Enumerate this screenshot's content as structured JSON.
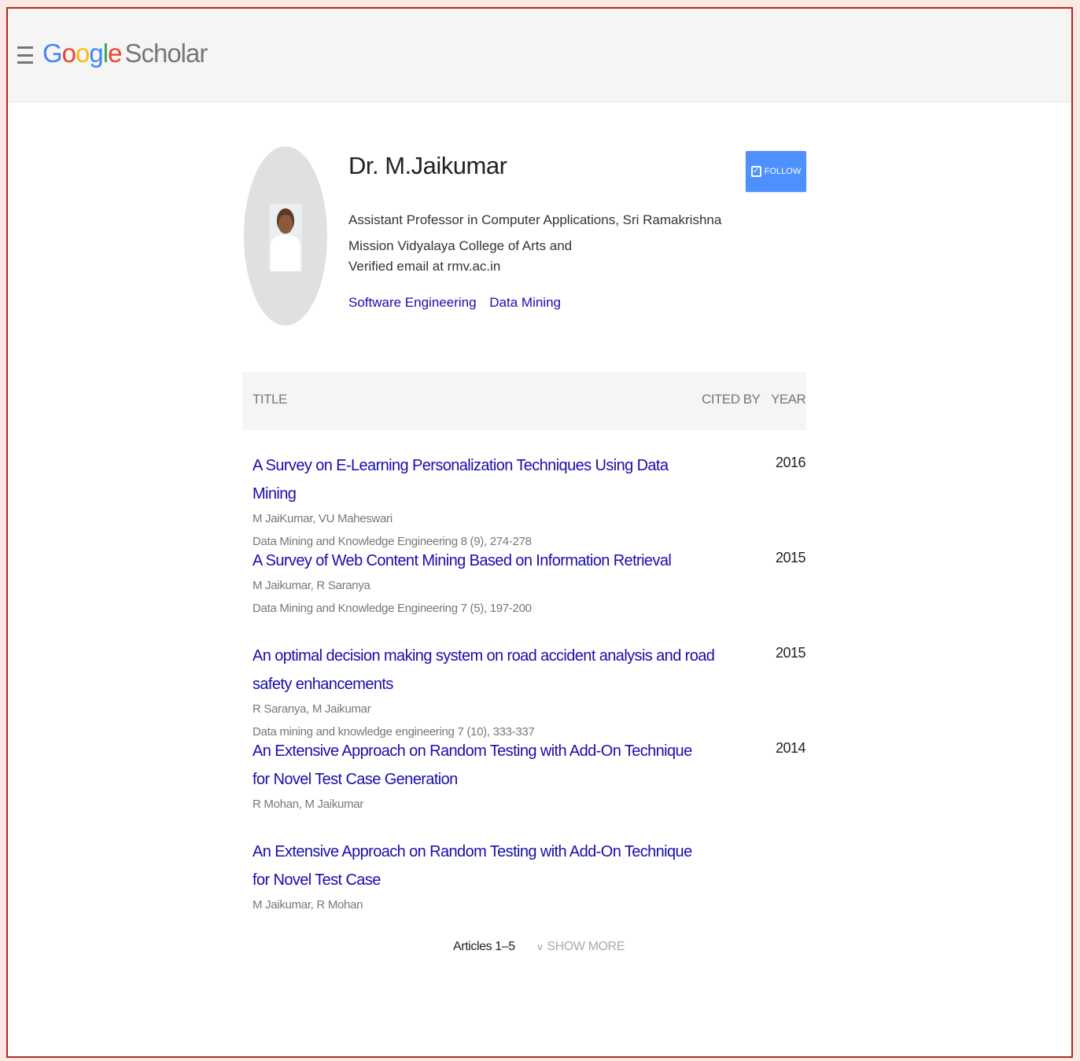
{
  "header": {
    "brand_letters": [
      "G",
      "o",
      "o",
      "g",
      "l",
      "e"
    ],
    "brand_suffix": "Scholar"
  },
  "profile": {
    "name": "Dr. M.Jaikumar",
    "affiliation": "Assistant Professor in Computer Applications, Sri Ramakrishna Mission Vidyalaya College of Arts and",
    "email": "Verified email at rmv.ac.in",
    "interests": [
      "Software Engineering",
      "Data Mining"
    ],
    "follow_label": "FOLLOW",
    "follow_icon": "✓"
  },
  "table": {
    "col_title": "TITLE",
    "col_cited": "CITED BY",
    "col_year": "YEAR"
  },
  "articles": [
    {
      "title": "A Survey on E-Learning Personalization Techniques Using Data Mining",
      "authors": "M JaiKumar, VU Maheswari",
      "venue": "Data Mining and Knowledge Engineering 8 (9), 274-278",
      "year": "2016"
    },
    {
      "title": "A Survey of Web Content Mining Based on Information Retrieval",
      "authors": "M Jaikumar, R Saranya",
      "venue": "Data Mining and Knowledge Engineering 7 (5), 197-200",
      "year": "2015"
    },
    {
      "title": "An optimal decision making system on road accident analysis and road safety enhancements",
      "authors": "R Saranya, M Jaikumar",
      "venue": "Data mining and knowledge engineering 7 (10), 333-337",
      "year": "2015"
    },
    {
      "title": "An Extensive Approach on Random Testing with Add-On Technique for Novel Test Case Generation",
      "authors": "R Mohan, M Jaikumar",
      "venue": "",
      "year": "2014"
    },
    {
      "title": "An Extensive Approach on Random Testing with Add-On Technique for Novel Test Case",
      "authors": "M Jaikumar, R Mohan",
      "venue": "",
      "year": ""
    }
  ],
  "footer": {
    "articles_range": "Articles 1–5",
    "chevron": "v",
    "show_more": "SHOW MORE"
  }
}
